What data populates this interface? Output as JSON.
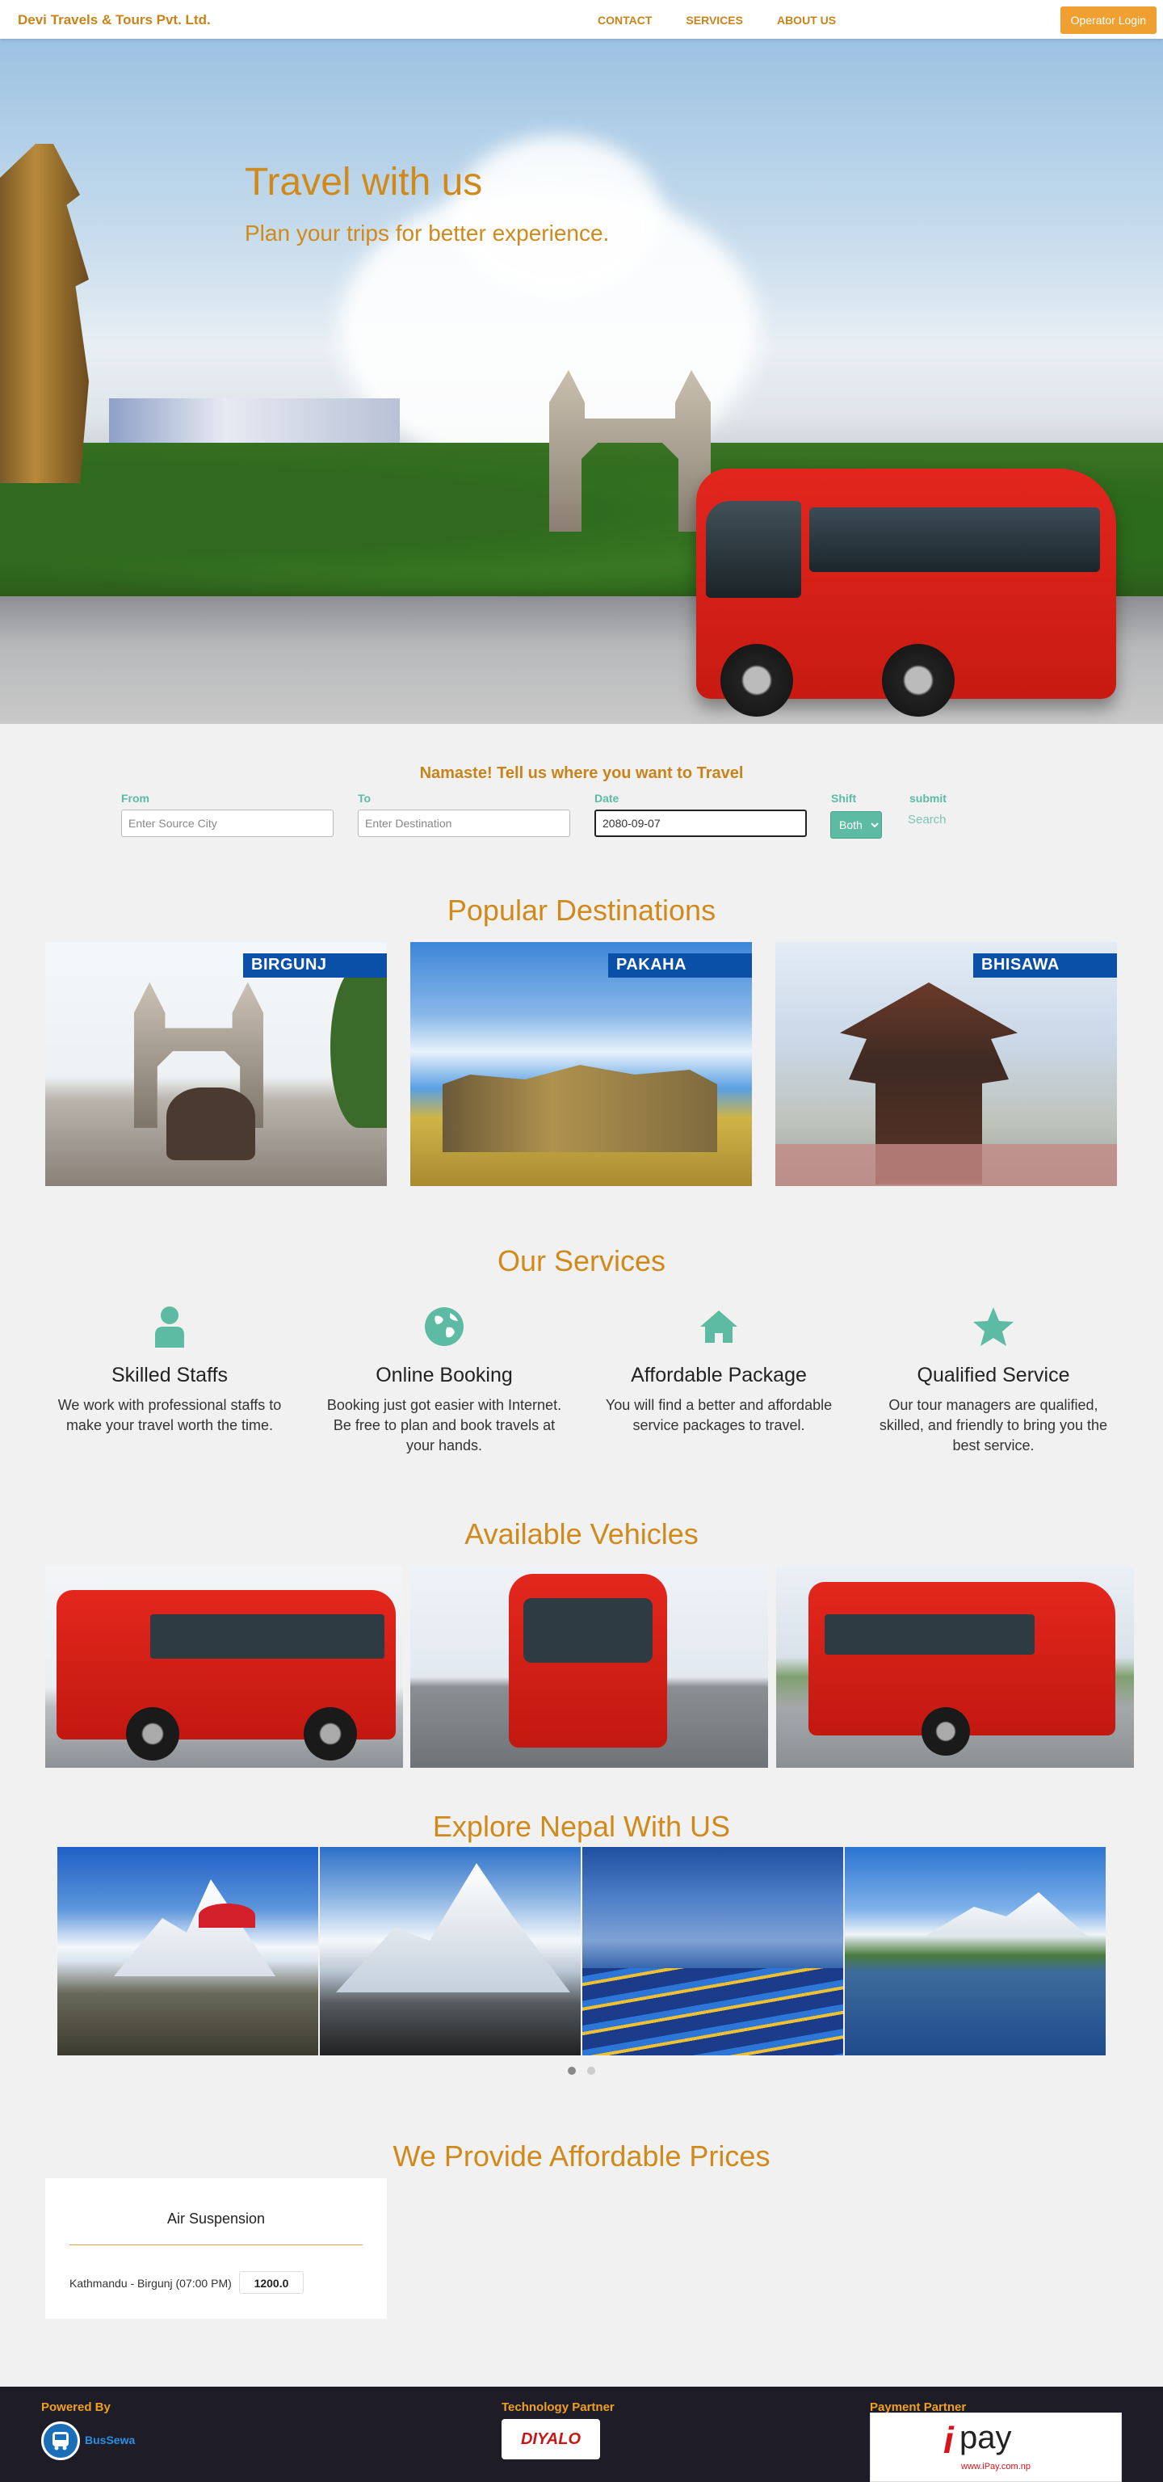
{
  "nav": {
    "brand": "Devi Travels & Tours Pvt. Ltd.",
    "links": [
      "CONTACT",
      "SERVICES",
      "ABOUT US"
    ],
    "operator_login": "Operator Login"
  },
  "hero": {
    "title": "Travel with us",
    "subtitle": "Plan your trips for better experience."
  },
  "search": {
    "heading": "Namaste! Tell us where you want to Travel",
    "from_label": "From",
    "from_placeholder": "Enter Source City",
    "to_label": "To",
    "to_placeholder": "Enter Destination",
    "date_label": "Date",
    "date_value": "2080-09-07",
    "shift_label": "Shift",
    "shift_value": "Both",
    "submit_label": "submit",
    "search_link": "Search"
  },
  "destinations": {
    "title": "Popular Destinations",
    "items": [
      {
        "name": "BIRGUNJ"
      },
      {
        "name": "PAKAHA"
      },
      {
        "name": "BHISAWA"
      }
    ]
  },
  "services": {
    "title": "Our Services",
    "items": [
      {
        "icon": "person-icon",
        "title": "Skilled Staffs",
        "text": "We work with professional staffs to make your travel worth the time."
      },
      {
        "icon": "globe-icon",
        "title": "Online Booking",
        "text": "Booking just got easier with Internet. Be free to plan and book travels at your hands."
      },
      {
        "icon": "home-icon",
        "title": "Affordable Package",
        "text": "You will find a better and affordable service packages to travel."
      },
      {
        "icon": "star-icon",
        "title": "Qualified Service",
        "text": "Our tour managers are qualified, skilled, and friendly to bring you the best service."
      }
    ],
    "icon_color": "#5dbba4"
  },
  "vehicles": {
    "title": "Available Vehicles"
  },
  "explore": {
    "title": "Explore Nepal With US",
    "active_slide": 1,
    "slide_count": 2
  },
  "prices": {
    "title": "We Provide Affordable Prices",
    "cards": [
      {
        "category": "Air Suspension",
        "route": "Kathmandu - Birgunj (07:00 PM)",
        "price": "1200.0"
      }
    ]
  },
  "footer": {
    "powered_by": "Powered By",
    "powered_name": "BusSewa",
    "tech_partner": "Technology Partner",
    "tech_name": "DIYALO",
    "payment_partner": "Payment Partner",
    "payment_name": "pay",
    "payment_url": "www.iPay.com.np"
  },
  "colors": {
    "accent": "#d08a1c",
    "teal": "#5dbba4",
    "operator_button": "#f0a030",
    "footer_bg": "#1d1c27"
  }
}
